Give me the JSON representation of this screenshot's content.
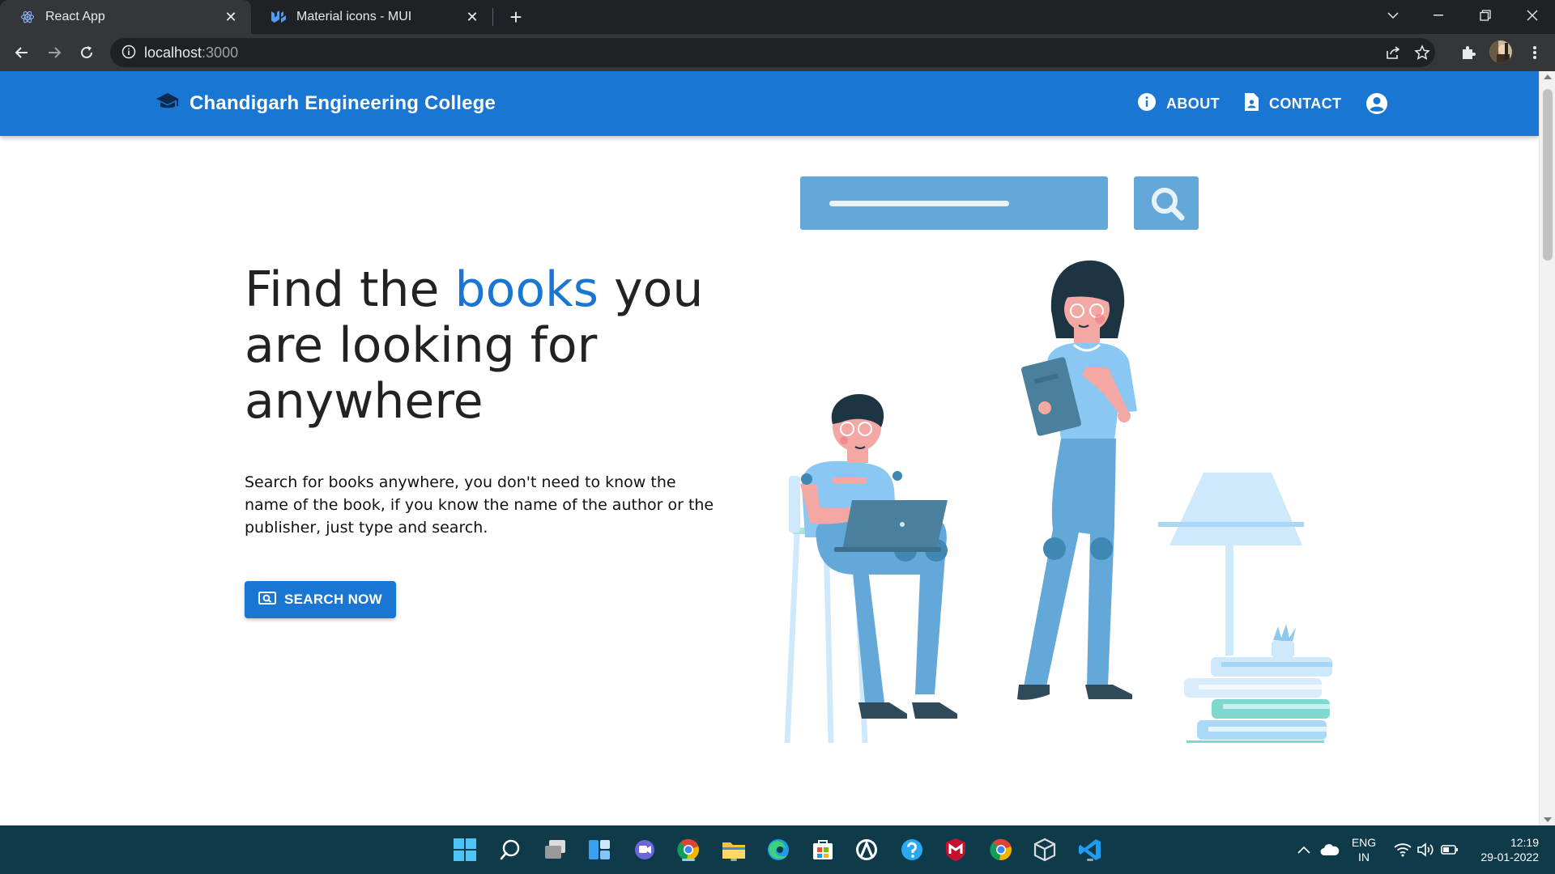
{
  "browser": {
    "tabs": [
      {
        "title": "React App",
        "active": true,
        "favicon": "react-icon"
      },
      {
        "title": "Material icons - MUI",
        "active": false,
        "favicon": "mui-icon"
      }
    ],
    "url_host": "localhost",
    "url_port": ":3000"
  },
  "navbar": {
    "brand_icon": "graduation-cap-icon",
    "brand_name": "Chandigarh Engineering College",
    "links": [
      {
        "label": "ABOUT",
        "icon": "info-icon"
      },
      {
        "label": "CONTACT",
        "icon": "contact-page-icon"
      }
    ],
    "account_icon": "account-circle-icon",
    "color": "#1976d2"
  },
  "hero": {
    "title_before": "Find the ",
    "title_highlight": "books",
    "title_after": " you are looking for anywhere",
    "description": "Search for books anywhere, you don't need to know the name of the book, if you know the name of the author or the publisher, just type and search.",
    "cta_label": "SEARCH NOW",
    "cta_icon": "image-search-icon",
    "accent_color": "#1976d2"
  },
  "taskbar": {
    "apps": [
      "start-icon",
      "search-icon",
      "task-view-icon",
      "widgets-icon",
      "chat-icon",
      "chrome-canary-icon",
      "file-explorer-icon",
      "edge-icon",
      "store-icon",
      "app-icon",
      "help-icon",
      "mcafee-icon",
      "chrome-icon",
      "virtualbox-icon",
      "vscode-icon"
    ],
    "language": "ENG",
    "region": "IN",
    "time": "12:19",
    "date": "29-01-2022"
  }
}
